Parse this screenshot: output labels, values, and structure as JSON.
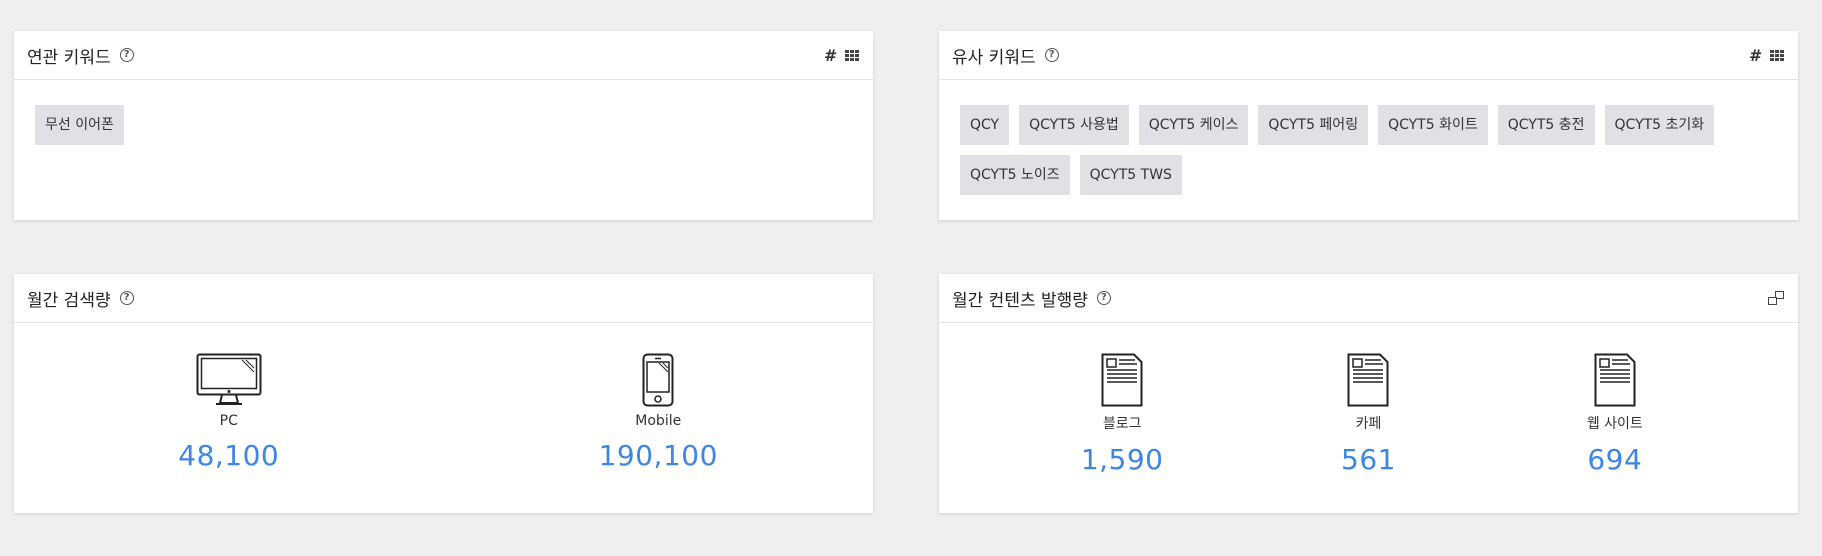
{
  "related": {
    "title": "연관 키워드",
    "tags": [
      "무선 이어폰"
    ]
  },
  "similar": {
    "title": "유사 키워드",
    "tags": [
      "QCY",
      "QCYT5 사용법",
      "QCYT5 케이스",
      "QCYT5 페어링",
      "QCYT5 화이트",
      "QCYT5 충전",
      "QCYT5 초기화",
      "QCYT5 노이즈",
      "QCYT5 TWS"
    ]
  },
  "search_volume": {
    "title": "월간 검색량",
    "pc": {
      "label": "PC",
      "value": "48,100",
      "icon": "desktop-monitor-icon"
    },
    "mobile": {
      "label": "Mobile",
      "value": "190,100",
      "icon": "smartphone-icon"
    }
  },
  "content_volume": {
    "title": "월간 컨텐츠 발행량",
    "blog": {
      "label": "블로그",
      "value": "1,590",
      "icon": "document-icon"
    },
    "cafe": {
      "label": "카페",
      "value": "561",
      "icon": "document-icon"
    },
    "website": {
      "label": "웹 사이트",
      "value": "694",
      "icon": "document-icon"
    }
  },
  "colors": {
    "accent": "#3d86e2",
    "background": "#efefef",
    "tag": "#dfe1e4"
  }
}
